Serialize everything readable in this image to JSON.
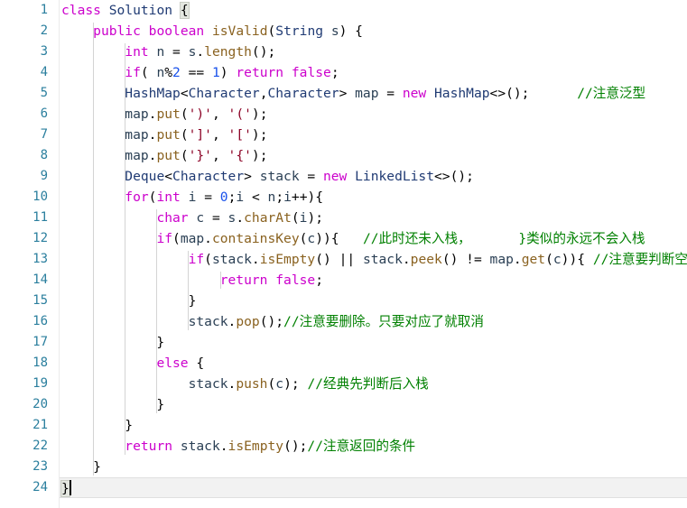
{
  "editor": {
    "language": "Java",
    "line_count": 24,
    "current_line": 24,
    "colors": {
      "background": "#ffffff",
      "gutter_text": "#2b7f9e",
      "keyword": "#cc00cc",
      "type": "#1f3a73",
      "identifier": "#2a3f54",
      "method": "#8a6220",
      "number": "#1750eb",
      "char_literal": "#8b0024",
      "comment": "#008000",
      "current_line_bg": "#f2f2f2",
      "brace_match_bg": "#e4e7e0"
    }
  },
  "gutter": {
    "line_numbers": [
      "1",
      "2",
      "3",
      "4",
      "5",
      "6",
      "7",
      "8",
      "9",
      "10",
      "11",
      "12",
      "13",
      "14",
      "15",
      "16",
      "17",
      "18",
      "19",
      "20",
      "21",
      "22",
      "23",
      "24"
    ]
  },
  "code": {
    "lines": [
      {
        "n": 1,
        "text": "class Solution {"
      },
      {
        "n": 2,
        "text": "    public boolean isValid(String s) {"
      },
      {
        "n": 3,
        "text": "        int n = s.length();"
      },
      {
        "n": 4,
        "text": "        if( n%2 == 1) return false;"
      },
      {
        "n": 5,
        "text": "        HashMap<Character,Character> map = new HashMap<>();      //注意泛型"
      },
      {
        "n": 6,
        "text": "        map.put(')', '(');"
      },
      {
        "n": 7,
        "text": "        map.put(']', '[');"
      },
      {
        "n": 8,
        "text": "        map.put('}', '{');"
      },
      {
        "n": 9,
        "text": "        Deque<Character> stack = new LinkedList<>();"
      },
      {
        "n": 10,
        "text": "        for(int i = 0;i < n;i++){"
      },
      {
        "n": 11,
        "text": "            char c = s.charAt(i);"
      },
      {
        "n": 12,
        "text": "            if(map.containsKey(c)){   //此时还未入栈，      }类似的永远不会入栈"
      },
      {
        "n": 13,
        "text": "                if(stack.isEmpty() || stack.peek() != map.get(c)){ //注意要判断空"
      },
      {
        "n": 14,
        "text": "                    return false;"
      },
      {
        "n": 15,
        "text": "                }"
      },
      {
        "n": 16,
        "text": "                stack.pop();//注意要删除。只要对应了就取消"
      },
      {
        "n": 17,
        "text": "            }"
      },
      {
        "n": 18,
        "text": "            else {"
      },
      {
        "n": 19,
        "text": "                stack.push(c); //经典先判断后入栈"
      },
      {
        "n": 20,
        "text": "            }"
      },
      {
        "n": 21,
        "text": "        }"
      },
      {
        "n": 22,
        "text": "        return stack.isEmpty();//注意返回的条件"
      },
      {
        "n": 23,
        "text": "    }"
      },
      {
        "n": 24,
        "text": "}"
      }
    ],
    "comments": [
      "//注意泛型",
      "//此时还未入栈，      }类似的永远不会入栈",
      "//注意要判断空",
      "//注意要删除。只要对应了就取消",
      "//经典先判断后入栈",
      "//注意返回的条件"
    ]
  },
  "tokens": {
    "l1": [
      [
        "kw",
        "class"
      ],
      [
        "op",
        " "
      ],
      [
        "type",
        "Solution"
      ],
      [
        "op",
        " "
      ],
      [
        "bm",
        "{"
      ]
    ],
    "l2": [
      [
        "op",
        "    "
      ],
      [
        "kw",
        "public"
      ],
      [
        "op",
        " "
      ],
      [
        "kw",
        "boolean"
      ],
      [
        "op",
        " "
      ],
      [
        "meth",
        "isValid"
      ],
      [
        "op",
        "("
      ],
      [
        "type",
        "String"
      ],
      [
        "op",
        " "
      ],
      [
        "id",
        "s"
      ],
      [
        "op",
        ") {"
      ]
    ],
    "l3": [
      [
        "op",
        "        "
      ],
      [
        "kw",
        "int"
      ],
      [
        "op",
        " "
      ],
      [
        "id",
        "n"
      ],
      [
        "op",
        " = "
      ],
      [
        "id",
        "s"
      ],
      [
        "op",
        "."
      ],
      [
        "meth",
        "length"
      ],
      [
        "op",
        "();"
      ]
    ],
    "l4": [
      [
        "op",
        "        "
      ],
      [
        "kw",
        "if"
      ],
      [
        "op",
        "( "
      ],
      [
        "id",
        "n"
      ],
      [
        "op",
        "%"
      ],
      [
        "num",
        "2"
      ],
      [
        "op",
        " == "
      ],
      [
        "num",
        "1"
      ],
      [
        "op",
        ") "
      ],
      [
        "kw",
        "return"
      ],
      [
        "op",
        " "
      ],
      [
        "kw",
        "false"
      ],
      [
        "op",
        ";"
      ]
    ],
    "l5": [
      [
        "op",
        "        "
      ],
      [
        "type",
        "HashMap"
      ],
      [
        "op",
        "<"
      ],
      [
        "type",
        "Character"
      ],
      [
        "op",
        ","
      ],
      [
        "type",
        "Character"
      ],
      [
        "op",
        "> "
      ],
      [
        "id",
        "map"
      ],
      [
        "op",
        " = "
      ],
      [
        "kw",
        "new"
      ],
      [
        "op",
        " "
      ],
      [
        "type",
        "HashMap"
      ],
      [
        "op",
        "<>();      "
      ],
      [
        "cmt",
        "//注意泛型"
      ]
    ],
    "l6": [
      [
        "op",
        "        "
      ],
      [
        "id",
        "map"
      ],
      [
        "op",
        "."
      ],
      [
        "meth",
        "put"
      ],
      [
        "op",
        "("
      ],
      [
        "chr",
        "')'"
      ],
      [
        "op",
        ", "
      ],
      [
        "chr",
        "'('"
      ],
      [
        "op",
        ");"
      ]
    ],
    "l7": [
      [
        "op",
        "        "
      ],
      [
        "id",
        "map"
      ],
      [
        "op",
        "."
      ],
      [
        "meth",
        "put"
      ],
      [
        "op",
        "("
      ],
      [
        "chr",
        "']'"
      ],
      [
        "op",
        ", "
      ],
      [
        "chr",
        "'['"
      ],
      [
        "op",
        ");"
      ]
    ],
    "l8": [
      [
        "op",
        "        "
      ],
      [
        "id",
        "map"
      ],
      [
        "op",
        "."
      ],
      [
        "meth",
        "put"
      ],
      [
        "op",
        "("
      ],
      [
        "chr",
        "'}'"
      ],
      [
        "op",
        ", "
      ],
      [
        "chr",
        "'{'"
      ],
      [
        "op",
        ");"
      ]
    ],
    "l9": [
      [
        "op",
        "        "
      ],
      [
        "type",
        "Deque"
      ],
      [
        "op",
        "<"
      ],
      [
        "type",
        "Character"
      ],
      [
        "op",
        "> "
      ],
      [
        "id",
        "stack"
      ],
      [
        "op",
        " = "
      ],
      [
        "kw",
        "new"
      ],
      [
        "op",
        " "
      ],
      [
        "type",
        "LinkedList"
      ],
      [
        "op",
        "<>();"
      ]
    ],
    "l10": [
      [
        "op",
        "        "
      ],
      [
        "kw",
        "for"
      ],
      [
        "op",
        "("
      ],
      [
        "kw",
        "int"
      ],
      [
        "op",
        " "
      ],
      [
        "id",
        "i"
      ],
      [
        "op",
        " = "
      ],
      [
        "num",
        "0"
      ],
      [
        "op",
        ";"
      ],
      [
        "id",
        "i"
      ],
      [
        "op",
        " < "
      ],
      [
        "id",
        "n"
      ],
      [
        "op",
        ";"
      ],
      [
        "id",
        "i"
      ],
      [
        "op",
        "++){"
      ]
    ],
    "l11": [
      [
        "op",
        "            "
      ],
      [
        "kw",
        "char"
      ],
      [
        "op",
        " "
      ],
      [
        "id",
        "c"
      ],
      [
        "op",
        " = "
      ],
      [
        "id",
        "s"
      ],
      [
        "op",
        "."
      ],
      [
        "meth",
        "charAt"
      ],
      [
        "op",
        "("
      ],
      [
        "id",
        "i"
      ],
      [
        "op",
        ");"
      ]
    ],
    "l12": [
      [
        "op",
        "            "
      ],
      [
        "kw",
        "if"
      ],
      [
        "op",
        "("
      ],
      [
        "id",
        "map"
      ],
      [
        "op",
        "."
      ],
      [
        "meth",
        "containsKey"
      ],
      [
        "op",
        "("
      ],
      [
        "id",
        "c"
      ],
      [
        "op",
        ")){   "
      ],
      [
        "cmt",
        "//此时还未入栈，      }类似的永远不会入栈"
      ]
    ],
    "l13": [
      [
        "op",
        "                "
      ],
      [
        "kw",
        "if"
      ],
      [
        "op",
        "("
      ],
      [
        "id",
        "stack"
      ],
      [
        "op",
        "."
      ],
      [
        "meth",
        "isEmpty"
      ],
      [
        "op",
        "() || "
      ],
      [
        "id",
        "stack"
      ],
      [
        "op",
        "."
      ],
      [
        "meth",
        "peek"
      ],
      [
        "op",
        "() != "
      ],
      [
        "id",
        "map"
      ],
      [
        "op",
        "."
      ],
      [
        "meth",
        "get"
      ],
      [
        "op",
        "("
      ],
      [
        "id",
        "c"
      ],
      [
        "op",
        ")){ "
      ],
      [
        "cmt",
        "//注意要判断空"
      ]
    ],
    "l14": [
      [
        "op",
        "                    "
      ],
      [
        "kw",
        "return"
      ],
      [
        "op",
        " "
      ],
      [
        "kw",
        "false"
      ],
      [
        "op",
        ";"
      ]
    ],
    "l15": [
      [
        "op",
        "                }"
      ]
    ],
    "l16": [
      [
        "op",
        "                "
      ],
      [
        "id",
        "stack"
      ],
      [
        "op",
        "."
      ],
      [
        "meth",
        "pop"
      ],
      [
        "op",
        "();"
      ],
      [
        "cmt",
        "//注意要删除。只要对应了就取消"
      ]
    ],
    "l17": [
      [
        "op",
        "            }"
      ]
    ],
    "l18": [
      [
        "op",
        "            "
      ],
      [
        "kw",
        "else"
      ],
      [
        "op",
        " {"
      ]
    ],
    "l19": [
      [
        "op",
        "                "
      ],
      [
        "id",
        "stack"
      ],
      [
        "op",
        "."
      ],
      [
        "meth",
        "push"
      ],
      [
        "op",
        "("
      ],
      [
        "id",
        "c"
      ],
      [
        "op",
        "); "
      ],
      [
        "cmt",
        "//经典先判断后入栈"
      ]
    ],
    "l20": [
      [
        "op",
        "            }"
      ]
    ],
    "l21": [
      [
        "op",
        "        }"
      ]
    ],
    "l22": [
      [
        "op",
        "        "
      ],
      [
        "kw",
        "return"
      ],
      [
        "op",
        " "
      ],
      [
        "id",
        "stack"
      ],
      [
        "op",
        "."
      ],
      [
        "meth",
        "isEmpty"
      ],
      [
        "op",
        "();"
      ],
      [
        "cmt",
        "//注意返回的条件"
      ]
    ],
    "l23": [
      [
        "op",
        "    }"
      ]
    ],
    "l24": [
      [
        "bm",
        "}"
      ],
      [
        "caret",
        ""
      ]
    ]
  },
  "indent_guides": {
    "description": "vertical indentation guide lines",
    "lines": [
      {
        "level": 1,
        "from_line": 2,
        "to_line": 23
      },
      {
        "level": 2,
        "from_line": 3,
        "to_line": 22
      },
      {
        "level": 3,
        "from_line": 11,
        "to_line": 20
      },
      {
        "level": 4,
        "from_line": 13,
        "to_line": 16
      },
      {
        "level": 5,
        "from_line": 14,
        "to_line": 14
      }
    ]
  }
}
